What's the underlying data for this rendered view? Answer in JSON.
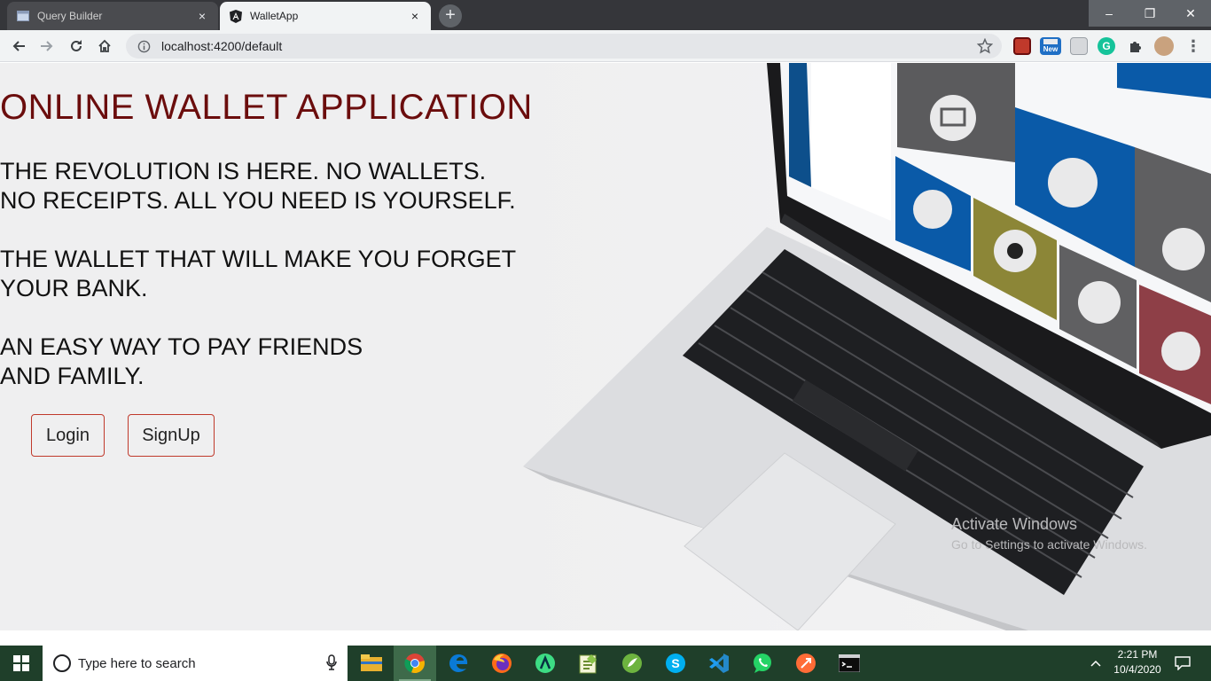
{
  "browser": {
    "tabs": [
      {
        "title": "Query Builder",
        "active": false
      },
      {
        "title": "WalletApp",
        "active": true
      }
    ],
    "close_glyph": "×",
    "new_tab_glyph": "+",
    "window_controls": {
      "minimize": "–",
      "maximize": "❐",
      "close": "✕"
    },
    "url": "localhost:4200/default",
    "extensions": [
      "tampermonkey-icon",
      "new-badge-icon",
      "cast-icon",
      "grammarly-icon",
      "puzzle-icon",
      "profile-avatar"
    ],
    "new_badge": "New"
  },
  "page": {
    "title": "ONLINE WALLET APPLICATION",
    "taglines": [
      {
        "line1": "THE REVOLUTION IS HERE. NO WALLETS.",
        "line2": "NO RECEIPTS. ALL YOU NEED IS YOURSELF."
      },
      {
        "line1": "THE WALLET THAT WILL MAKE YOU FORGET",
        "line2": "YOUR BANK."
      },
      {
        "line1": "AN EASY WAY TO PAY FRIENDS",
        "line2": "AND FAMILY."
      }
    ],
    "buttons": {
      "login": "Login",
      "signup": "SignUp"
    },
    "accent_color": "#6b0d0d",
    "button_border_color": "#c0392b"
  },
  "watermark": {
    "line1": "Activate Windows",
    "line2": "Go to Settings to activate Windows."
  },
  "taskbar": {
    "search_placeholder": "Type here to search",
    "apps": [
      "file-explorer-icon",
      "chrome-icon",
      "edge-icon",
      "firefox-icon",
      "android-studio-icon",
      "notepad-plus-icon",
      "spring-icon",
      "skype-icon",
      "vscode-icon",
      "whatsapp-icon",
      "postman-icon",
      "terminal-icon"
    ],
    "time": "2:21 PM",
    "date": "10/4/2020"
  }
}
